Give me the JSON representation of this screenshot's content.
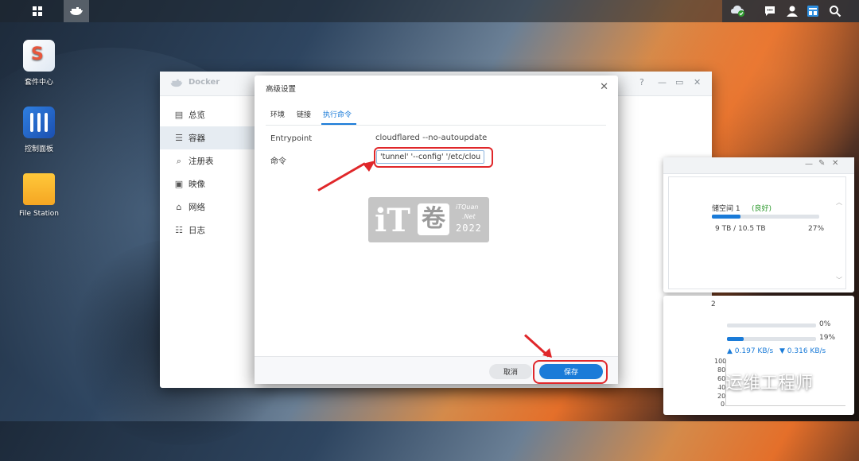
{
  "desktop": {
    "icons": [
      {
        "label": "套件中心"
      },
      {
        "label": "控制面板"
      },
      {
        "label": "File Station"
      }
    ]
  },
  "docker": {
    "title": "Docker",
    "window_controls": {
      "help": "?",
      "minimize": "—",
      "maximize": "▭",
      "close": "✕"
    },
    "sidebar": [
      {
        "icon": "overview-icon",
        "label": "总览"
      },
      {
        "icon": "container-icon",
        "label": "容器"
      },
      {
        "icon": "registry-icon",
        "label": "注册表"
      },
      {
        "icon": "image-icon",
        "label": "映像"
      },
      {
        "icon": "network-icon",
        "label": "网络"
      },
      {
        "icon": "log-icon",
        "label": "日志"
      }
    ]
  },
  "dialog": {
    "title": "高级设置",
    "close": "✕",
    "tabs": [
      {
        "label": "环境"
      },
      {
        "label": "链接"
      },
      {
        "label": "执行命令",
        "active": true
      }
    ],
    "entrypoint_label": "Entrypoint",
    "entrypoint_value": "cloudflared --no-autoupdate",
    "command_label": "命令",
    "command_value": "'tunnel' '--config' '/etc/cloud",
    "cancel_label": "取消",
    "save_label": "保存"
  },
  "watermark": {
    "main": "iT",
    "char": "卷",
    "line1": "iTQuan",
    "line2": ".Net",
    "year": "2022"
  },
  "storage_widget": {
    "volume_label": "储空间 1",
    "status": "(良好)",
    "usage_text": "9 TB / 10.5 TB",
    "usage_percent_label": "27%",
    "usage_fraction": 0.27
  },
  "resource_widget": {
    "header": "2",
    "cpu_label": "0%",
    "cpu_fraction": 0.0,
    "ram_label": "19%",
    "ram_fraction": 0.19,
    "upload": "0.197 KB/s",
    "download": "0.316 KB/s",
    "chart_ticks": [
      "100",
      "80",
      "60",
      "40",
      "20",
      "0"
    ]
  },
  "brand": {
    "text": "运维工程师"
  },
  "colors": {
    "accent": "#1a7bd8",
    "annotation": "#e0272a",
    "success": "#2e9a2e"
  }
}
